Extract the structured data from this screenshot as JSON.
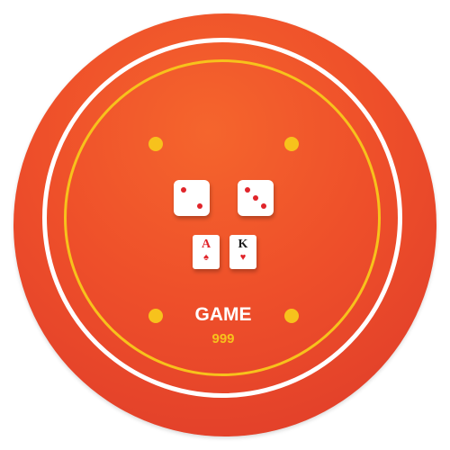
{
  "game": {
    "title": "GAME",
    "score": "999"
  },
  "dice": [
    {
      "value": 2
    },
    {
      "value": 3
    }
  ],
  "cards": [
    {
      "rank": "A",
      "suit": "♠",
      "rank_color": "#e0242a"
    },
    {
      "rank": "K",
      "suit": "♥",
      "rank_color": "#1a1a1a"
    }
  ],
  "colors": {
    "chip": "#ee4f2a",
    "accent": "#f7c21c",
    "ring": "#ffffff",
    "pip": "#e0242a"
  },
  "icons": {
    "dice": "die-icon",
    "cards": "playing-card-icon",
    "dots": "dot-icon"
  }
}
